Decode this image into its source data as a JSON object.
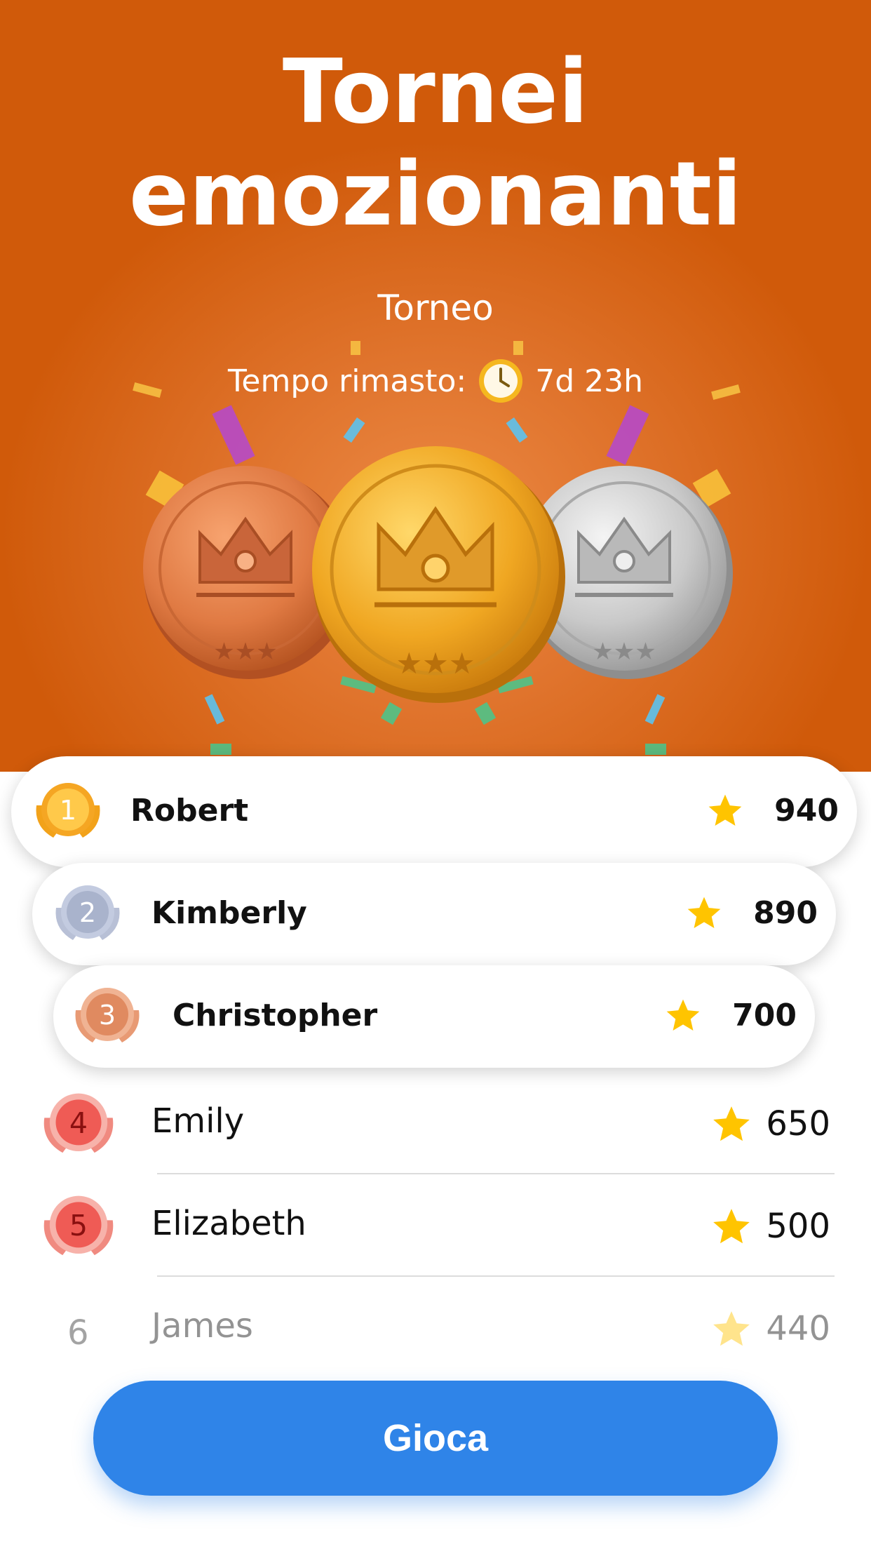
{
  "hero": {
    "title_line1": "Tornei",
    "title_line2": "emozionanti",
    "subtitle": "Torneo",
    "timer_label": "Tempo rimasto:",
    "timer_value": "7d 23h"
  },
  "leaderboard": [
    {
      "rank": "1",
      "name": "Robert",
      "score": "940"
    },
    {
      "rank": "2",
      "name": "Kimberly",
      "score": "890"
    },
    {
      "rank": "3",
      "name": "Christopher",
      "score": "700"
    },
    {
      "rank": "4",
      "name": "Emily",
      "score": "650"
    },
    {
      "rank": "5",
      "name": "Elizabeth",
      "score": "500"
    },
    {
      "rank": "6",
      "name": "James",
      "score": "440"
    }
  ],
  "play_button": {
    "label": "Gioca"
  },
  "colors": {
    "hero_orange": "#d05a0a",
    "gold": "#f5a623",
    "silver": "#b8c0d6",
    "bronze": "#e08a60",
    "red_badge": "#ef5b55",
    "star": "#ffc400",
    "button_blue": "#2f84e8"
  },
  "icons": {
    "clock": "clock-icon",
    "star": "star-icon",
    "rank_badge": "laurel-badge-icon",
    "medals": [
      "bronze-crown-medal",
      "gold-crown-medal",
      "silver-crown-medal"
    ]
  }
}
